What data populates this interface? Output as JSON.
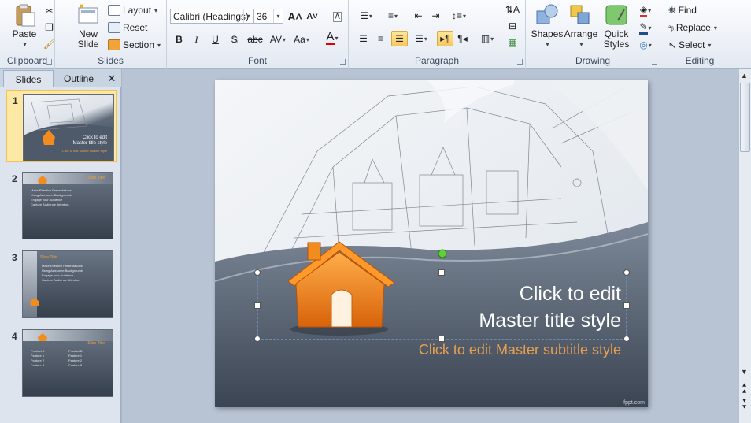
{
  "ribbon": {
    "clipboard": {
      "paste": "Paste",
      "label": "Clipboard"
    },
    "slides": {
      "new_slide_line1": "New",
      "new_slide_line2": "Slide",
      "layout": "Layout",
      "reset": "Reset",
      "section": "Section",
      "label": "Slides"
    },
    "font": {
      "font_name": "Calibri (Headings)",
      "font_size": "36",
      "bold": "B",
      "italic": "I",
      "underline": "U",
      "shadow": "S",
      "strike": "abc",
      "spacing": "AV",
      "case": "Aa",
      "color_a": "A",
      "label": "Font"
    },
    "paragraph": {
      "label": "Paragraph"
    },
    "drawing": {
      "shapes": "Shapes",
      "arrange": "Arrange",
      "quick_styles_line1": "Quick",
      "quick_styles_line2": "Styles",
      "label": "Drawing"
    },
    "editing": {
      "find": "Find",
      "replace": "Replace",
      "select": "Select",
      "label": "Editing"
    }
  },
  "panel": {
    "tabs": [
      "Slides",
      "Outline"
    ],
    "close": "✕",
    "thumbnails": [
      {
        "num": "1",
        "title_l1": "Click to edit",
        "title_l2": "Master title style",
        "subtitle": "Click to edit Master subtitle style"
      },
      {
        "num": "2",
        "title": "Slide Title",
        "bullets": [
          "Make Effective Presentations",
          "Using Awesome Backgrounds",
          "Engage your Audience",
          "Capture Audience Attention"
        ]
      },
      {
        "num": "3",
        "title": "Slide Title",
        "bullets": [
          "Make Effective Presentations",
          "Using Awesome Backgrounds",
          "Engage your Audience",
          "Capture Audience Attention"
        ]
      },
      {
        "num": "4",
        "title": "Slide Title",
        "col1_head": "Product A",
        "col2_head": "Product B",
        "features": [
          "Feature 1",
          "Feature 2",
          "Feature 3"
        ]
      }
    ]
  },
  "slide": {
    "title_line1": "Click to edit",
    "title_line2": "Master title style",
    "subtitle": "Click to edit Master subtitle style",
    "watermark": "fppt.com"
  },
  "colors": {
    "accent_orange": "#f28c1e",
    "subtitle_orange": "#e8a050",
    "selection": "#fde9a5"
  }
}
